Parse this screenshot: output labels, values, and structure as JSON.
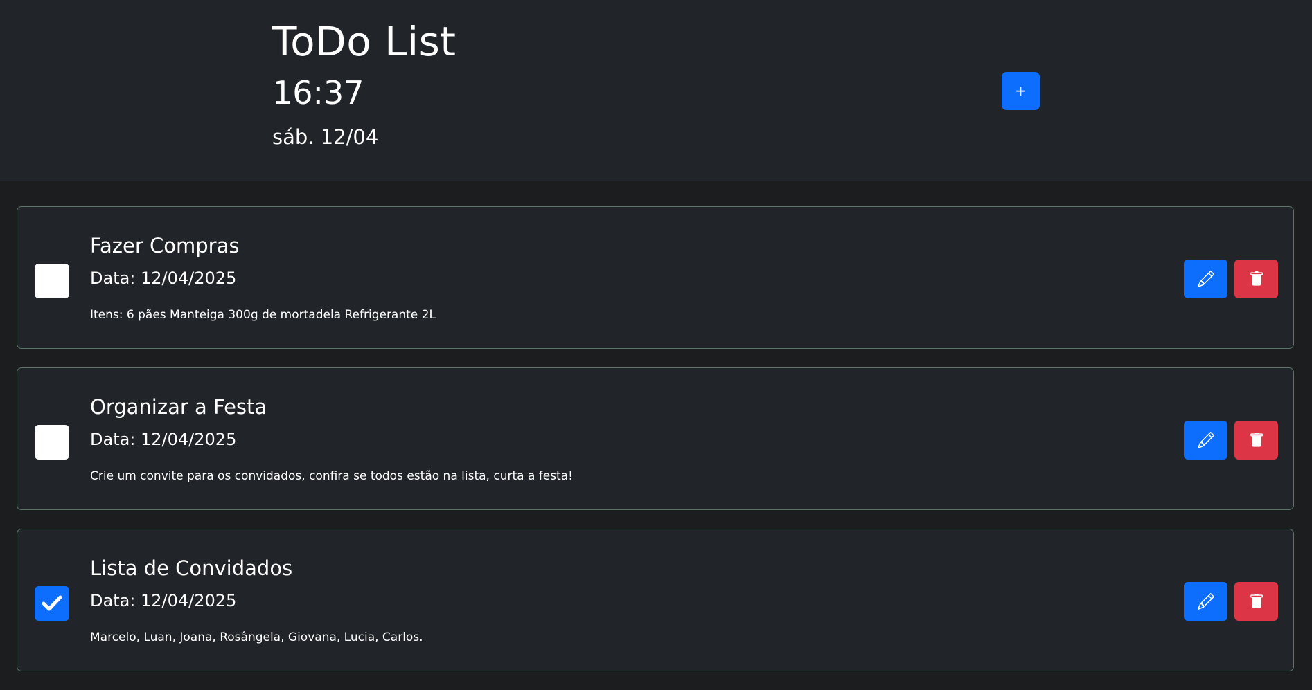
{
  "header": {
    "title": "ToDo List",
    "time": "16:37",
    "date": "sáb. 12/04",
    "add_label": "+"
  },
  "colors": {
    "primary": "#0d6efd",
    "danger": "#dc3545",
    "card_bg": "#212429",
    "page_bg": "#1c1d1f"
  },
  "tasks": [
    {
      "title": "Fazer Compras",
      "date": "Data: 12/04/2025",
      "description": "Itens: 6 pães Manteiga 300g de mortadela Refrigerante 2L",
      "completed": false,
      "icons": [
        "pencil-icon",
        "trash-icon"
      ]
    },
    {
      "title": "Organizar a Festa",
      "date": "Data: 12/04/2025",
      "description": "Crie um convite para os convidados, confira se todos estão na lista, curta a festa!",
      "completed": false,
      "icons": [
        "pencil-icon",
        "trash-icon"
      ]
    },
    {
      "title": "Lista de Convidados",
      "date": "Data: 12/04/2025",
      "description": "Marcelo, Luan, Joana, Rosângela, Giovana, Lucia, Carlos.",
      "completed": true,
      "icons": [
        "pencil-icon",
        "trash-icon"
      ]
    }
  ]
}
